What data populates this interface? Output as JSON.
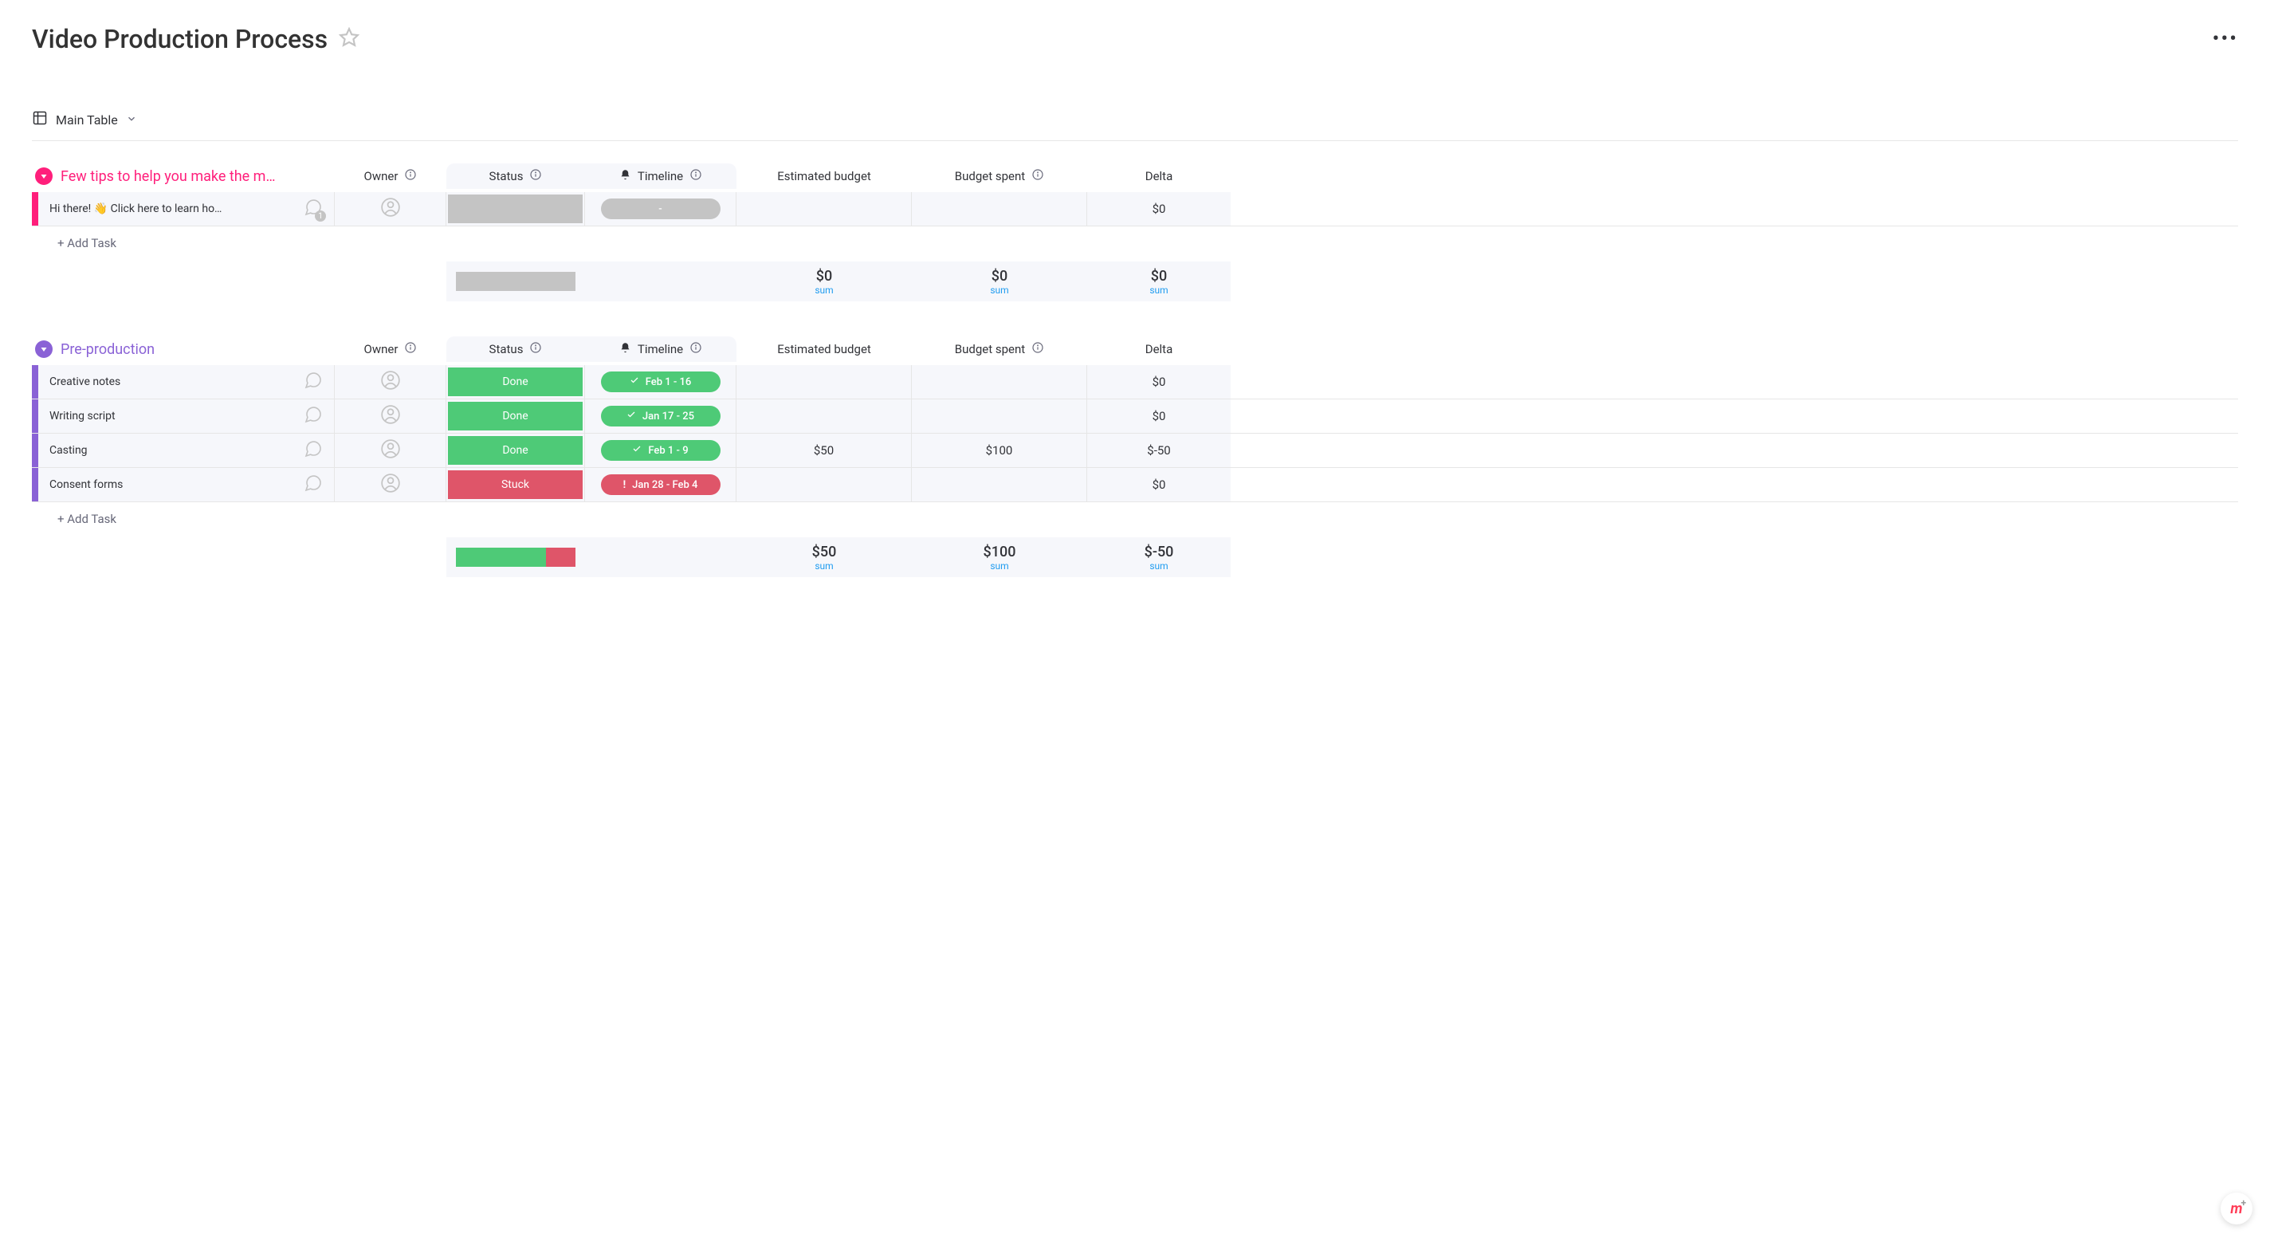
{
  "header": {
    "title": "Video Production Process"
  },
  "view": {
    "name": "Main Table"
  },
  "columns": {
    "owner": "Owner",
    "status": "Status",
    "timeline": "Timeline",
    "estimated_budget": "Estimated budget",
    "budget_spent": "Budget spent",
    "delta": "Delta"
  },
  "add_task_label": "+ Add Task",
  "sum_label": "sum",
  "groups": [
    {
      "id": "tips",
      "color": "#ff1f7b",
      "title": "Few tips to help you make the m…",
      "rows": [
        {
          "name": "Hi there! 👋 Click here to learn ho…",
          "chat_count": "1",
          "status": {
            "label": "",
            "type": "blank"
          },
          "timeline": {
            "label": "-",
            "type": "blank"
          },
          "estimated_budget": "",
          "budget_spent": "",
          "delta": "$0"
        }
      ],
      "footer": {
        "status_segments": [
          {
            "type": "blank",
            "pct": 100
          }
        ],
        "estimated_budget": "$0",
        "budget_spent": "$0",
        "delta": "$0"
      }
    },
    {
      "id": "preprod",
      "color": "#8a62d6",
      "title": "Pre-production",
      "rows": [
        {
          "name": "Creative notes",
          "status": {
            "label": "Done",
            "type": "done"
          },
          "timeline": {
            "label": "Feb 1 - 16",
            "type": "done"
          },
          "estimated_budget": "",
          "budget_spent": "",
          "delta": "$0"
        },
        {
          "name": "Writing script",
          "status": {
            "label": "Done",
            "type": "done"
          },
          "timeline": {
            "label": "Jan 17 - 25",
            "type": "done"
          },
          "estimated_budget": "",
          "budget_spent": "",
          "delta": "$0"
        },
        {
          "name": "Casting",
          "status": {
            "label": "Done",
            "type": "done"
          },
          "timeline": {
            "label": "Feb 1 - 9",
            "type": "done"
          },
          "estimated_budget": "$50",
          "budget_spent": "$100",
          "delta": "$-50"
        },
        {
          "name": "Consent forms",
          "status": {
            "label": "Stuck",
            "type": "stuck"
          },
          "timeline": {
            "label": "Jan 28 - Feb 4",
            "type": "stuck"
          },
          "estimated_budget": "",
          "budget_spent": "",
          "delta": "$0"
        }
      ],
      "footer": {
        "status_segments": [
          {
            "type": "done",
            "pct": 75
          },
          {
            "type": "stuck",
            "pct": 25
          }
        ],
        "estimated_budget": "$50",
        "budget_spent": "$100",
        "delta": "$-50"
      }
    }
  ]
}
